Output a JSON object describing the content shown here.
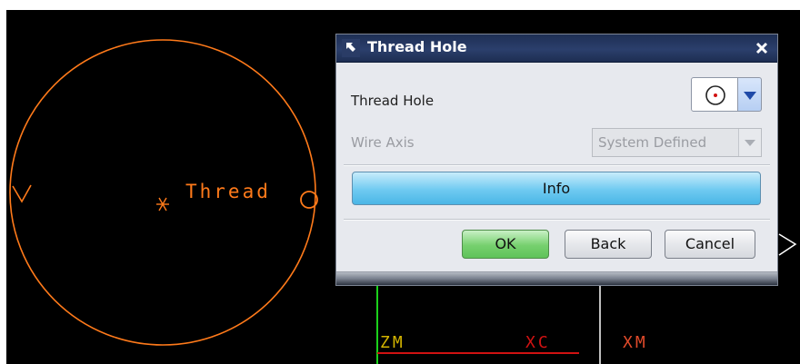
{
  "canvas": {
    "thread_label": "Thread",
    "zm_label": "ZM",
    "xc_label": "XC",
    "xm_label": "XM",
    "colors": {
      "background": "#000000",
      "geometry": "#ff7a1a",
      "axis_x": "#d11212",
      "axis_z": "#1bd11b",
      "axis_white": "#ffffff"
    }
  },
  "dialog": {
    "title": "Thread Hole",
    "title_icon": "arrow-icon",
    "close_icon": "close-icon",
    "thread_hole": {
      "label": "Thread Hole",
      "icon": "thread-hole-circle-icon"
    },
    "wire_axis": {
      "label": "Wire Axis",
      "value": "System Defined",
      "disabled": true
    },
    "info_label": "Info",
    "ok_label": "OK",
    "back_label": "Back",
    "cancel_label": "Cancel"
  }
}
